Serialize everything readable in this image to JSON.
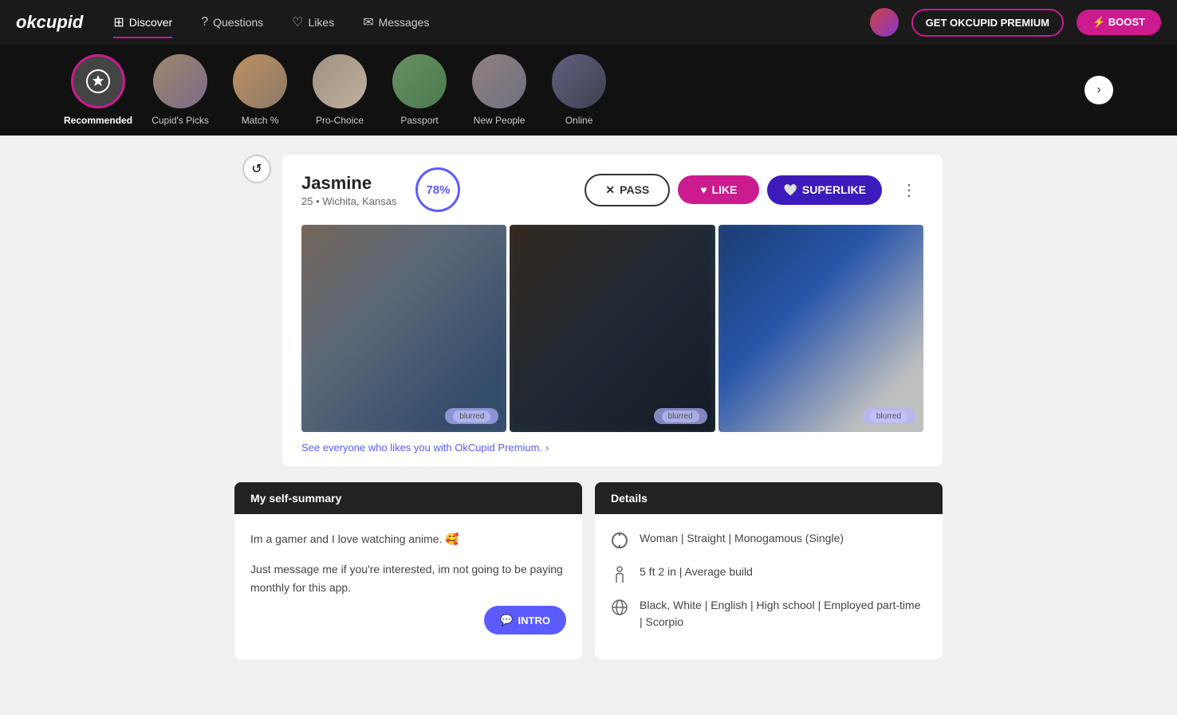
{
  "app": {
    "logo": "okcupid"
  },
  "navbar": {
    "items": [
      {
        "id": "discover",
        "label": "Discover",
        "icon": "🔍",
        "active": true
      },
      {
        "id": "questions",
        "label": "Questions",
        "icon": "❓",
        "active": false
      },
      {
        "id": "likes",
        "label": "Likes",
        "icon": "♡",
        "active": false
      },
      {
        "id": "messages",
        "label": "Messages",
        "icon": "💬",
        "active": false
      }
    ],
    "premium_btn": "GET OKCUPID PREMIUM",
    "boost_btn": "⚡ BOOST"
  },
  "categories": [
    {
      "id": "recommended",
      "label": "Recommended",
      "active": true
    },
    {
      "id": "cupids-picks",
      "label": "Cupid's Picks",
      "active": false
    },
    {
      "id": "match",
      "label": "Match %",
      "active": false
    },
    {
      "id": "pro-choice",
      "label": "Pro-Choice",
      "active": false
    },
    {
      "id": "passport",
      "label": "Passport",
      "active": false
    },
    {
      "id": "new-people",
      "label": "New People",
      "active": false
    },
    {
      "id": "online",
      "label": "Online",
      "active": false
    }
  ],
  "profile": {
    "name": "Jasmine",
    "age": "25",
    "location": "Wichita, Kansas",
    "match_pct": "78%",
    "pass_label": "PASS",
    "like_label": "LIKE",
    "superlike_label": "SUPERLIKE",
    "photo_badge_1": "blurred",
    "photo_badge_2": "blurred",
    "photo_badge_3": "blurred",
    "premium_prompt": "See everyone who likes you with OkCupid Premium.",
    "premium_arrow": "›"
  },
  "self_summary": {
    "header": "My self-summary",
    "text1": "Im a gamer and I love watching anime. 🥰",
    "text2": "Just message me if you're interested, im not going to be paying monthly for this app.",
    "intro_label": "INTRO",
    "intro_icon": "💬"
  },
  "details": {
    "header": "Details",
    "items": [
      {
        "icon": "gender",
        "text": "Woman | Straight | Monogamous (Single)"
      },
      {
        "icon": "height",
        "text": "5 ft 2 in | Average build"
      },
      {
        "icon": "globe",
        "text": "Black, White | English | High school | Employed part-time | Scorpio"
      }
    ]
  }
}
